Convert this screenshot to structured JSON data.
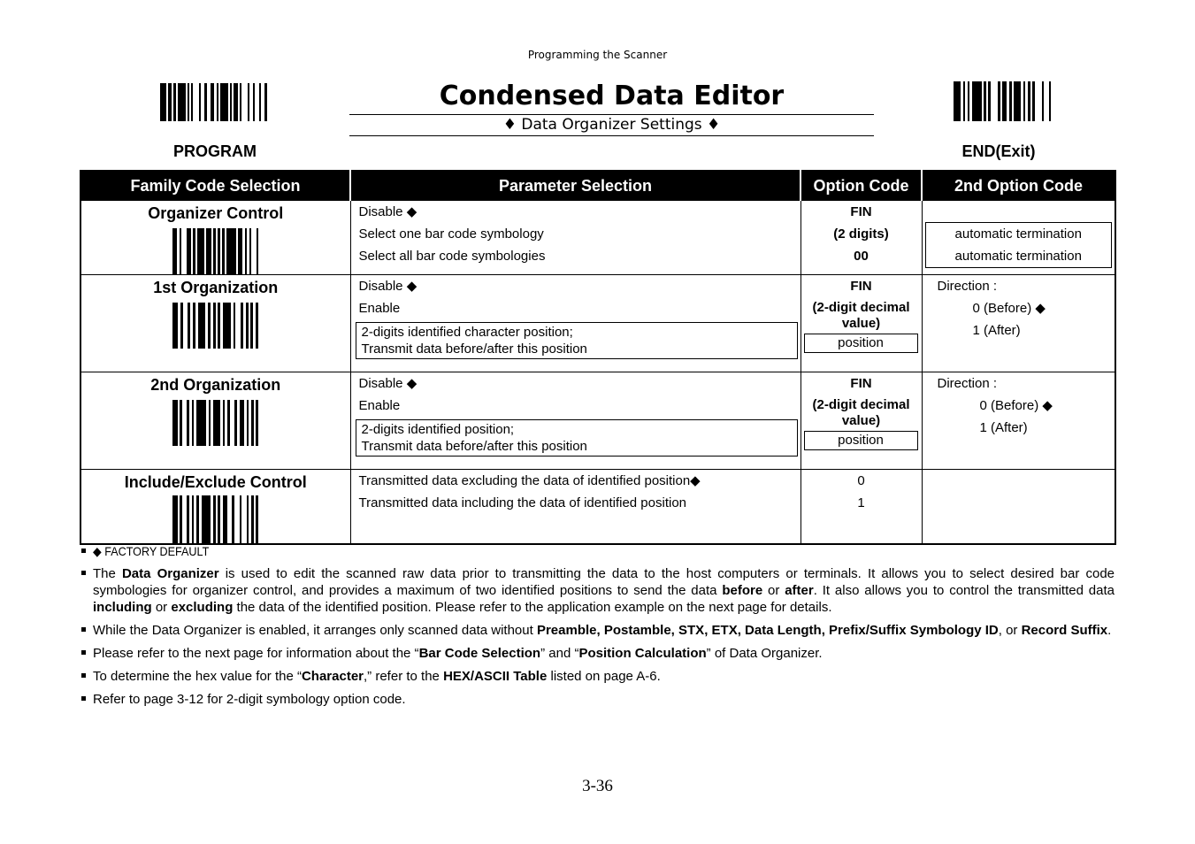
{
  "header": {
    "running_head": "Programming the Scanner",
    "title": "Condensed Data Editor",
    "subtitle": "♦ Data Organizer Settings ♦",
    "left_barcode_label": "PROGRAM",
    "right_barcode_label": "END(Exit)"
  },
  "table": {
    "columns": [
      "Family Code Selection",
      "Parameter Selection",
      "Option Code",
      "2nd Option Code"
    ],
    "rows": [
      {
        "family": "Organizer Control",
        "params": [
          "Disable ◆",
          "Select one bar code symbology",
          "Select all bar code symbologies"
        ],
        "options": [
          "FIN",
          "(2 digits)",
          "00"
        ],
        "second_option_box": [
          "automatic termination",
          "automatic termination"
        ]
      },
      {
        "family": "1st Organization",
        "params": [
          "Disable ◆",
          "Enable"
        ],
        "param_box": [
          "2-digits identified character position;",
          "Transmit data before/after this position"
        ],
        "options": [
          "FIN",
          "(2-digit decimal",
          "value)"
        ],
        "option_box": "position",
        "direction_label": "Direction :",
        "direction_values": [
          "0 (Before) ◆",
          "1 (After)"
        ]
      },
      {
        "family": "2nd Organization",
        "params": [
          "Disable ◆",
          "Enable"
        ],
        "param_box": [
          "2-digits identified position;",
          "Transmit data before/after this position"
        ],
        "options": [
          "FIN",
          "(2-digit decimal",
          "value)"
        ],
        "option_box": "position",
        "direction_label": "Direction :",
        "direction_values": [
          "0 (Before) ◆",
          "1 (After)"
        ]
      },
      {
        "family": "Include/Exclude Control",
        "params": [
          "Transmitted data excluding the data of identified position◆",
          "Transmitted data including the data of identified position"
        ],
        "options": [
          "0",
          "1"
        ]
      }
    ]
  },
  "notes": {
    "factory_default": "◆ FACTORY DEFAULT",
    "n1": {
      "a": "The ",
      "b": "Data Organizer",
      "c": " is used to edit the scanned raw data prior to transmitting the data to the host computers or terminals. It allows you to select desired bar code symbologies for organizer control, and provides a maximum of two identified positions to send the data ",
      "d": "before",
      "e": " or ",
      "f": "after",
      "g": ". It also allows you to control the transmitted data ",
      "h": "including",
      "i": " or ",
      "j": "excluding",
      "k": " the data of the identified position. Please refer to the application example on the next page for details."
    },
    "n2": {
      "a": "While the Data Organizer is enabled, it arranges only scanned data without ",
      "b": "Preamble, Postamble, STX, ETX, Data Length, Prefix/Suffix Symbology ID",
      "c": ", or ",
      "d": "Record Suffix",
      "e": "."
    },
    "n3": {
      "a": "Please refer to the next page for information about the “",
      "b": "Bar Code Selection",
      "c": "” and “",
      "d": "Position Calculation",
      "e": "” of Data Organizer."
    },
    "n4": {
      "a": "To determine the hex value for the “",
      "b": "Character",
      "c": ",” refer to the ",
      "d": "HEX/ASCII Table",
      "e": " listed on page A-6."
    },
    "n5": "Refer to page 3-12 for 2-digit symbology option code."
  },
  "footer": {
    "page_number": "3-36"
  }
}
